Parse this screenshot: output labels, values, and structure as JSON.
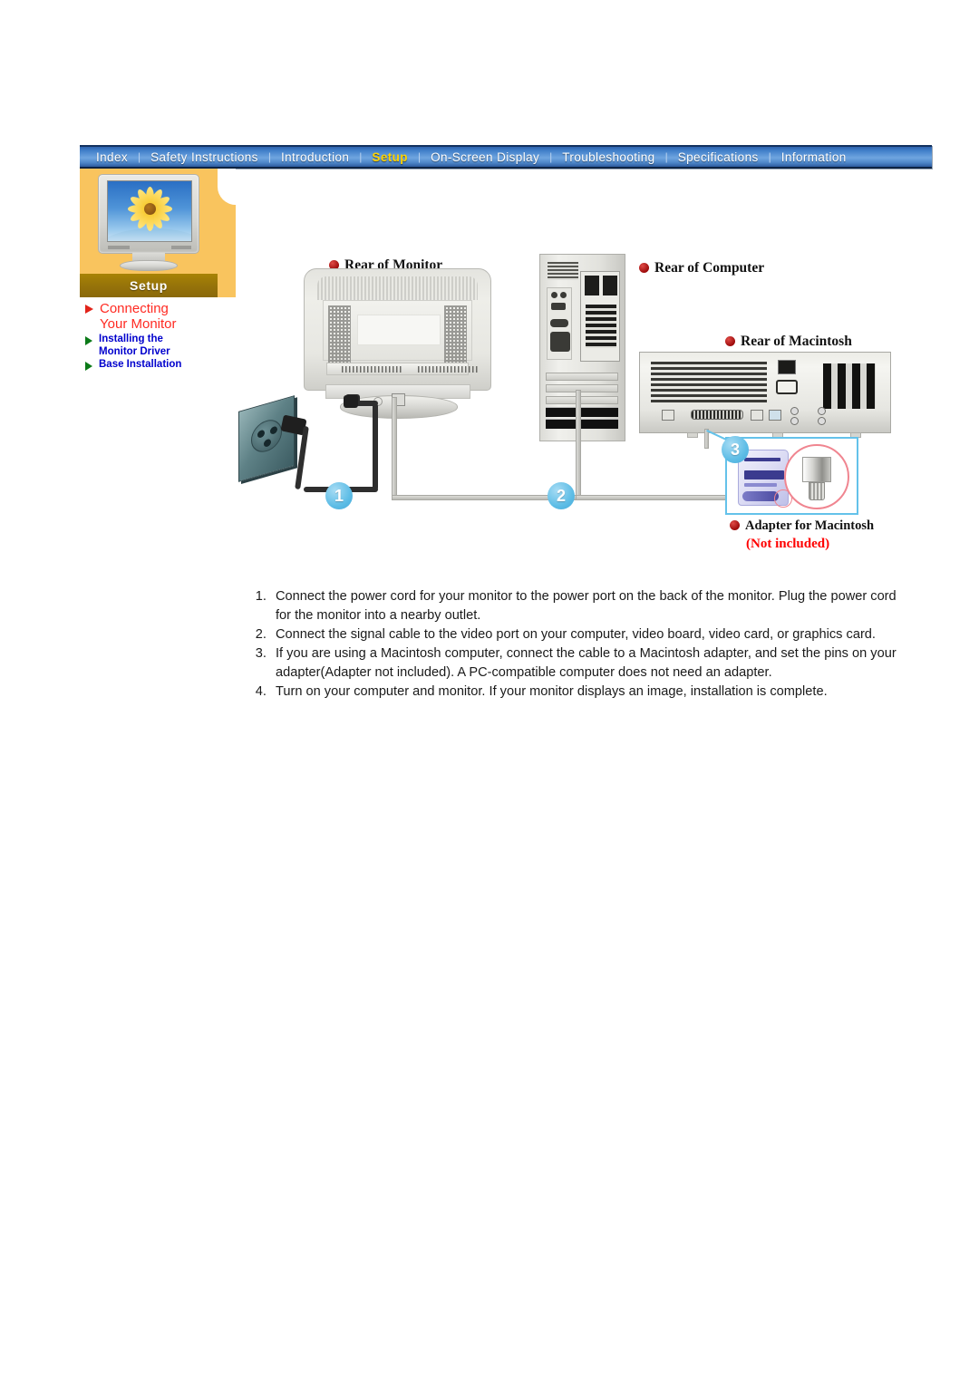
{
  "nav": {
    "items": [
      {
        "label": "Index",
        "active": false
      },
      {
        "label": "Safety Instructions",
        "active": false
      },
      {
        "label": "Introduction",
        "active": false
      },
      {
        "label": "Setup",
        "active": true
      },
      {
        "label": "On-Screen Display",
        "active": false
      },
      {
        "label": "Troubleshooting",
        "active": false
      },
      {
        "label": "Specifications",
        "active": false
      },
      {
        "label": "Information",
        "active": false
      }
    ],
    "separator": "|",
    "active_color": "#ffd400",
    "bar_color": "#3f7ec9"
  },
  "sidebar": {
    "section_title": "Setup",
    "panel_color": "#f9c45e",
    "title_bar_color": "#95720a",
    "thumbnail": "crt-monitor-sunflower-wallpaper",
    "links": [
      {
        "label_line1": "Connecting",
        "label_line2": "Your Monitor",
        "active": true,
        "color": "#ff2a22",
        "marker_color": "#e2231a"
      },
      {
        "label_line1": "Installing the",
        "label_line2": "Monitor Driver",
        "active": false,
        "color": "#0000cd",
        "marker_color": "#0b7a18"
      },
      {
        "label_line1": "Base Installation",
        "label_line2": "",
        "active": false,
        "color": "#0000cd",
        "marker_color": "#0b7a18"
      }
    ]
  },
  "diagram": {
    "labels": {
      "rear_of_monitor": "Rear of Monitor",
      "rear_of_computer": "Rear of Computer",
      "rear_of_macintosh": "Rear of  Macintosh",
      "adapter_for_macintosh": "Adapter for Macintosh",
      "not_included": "(Not included)"
    },
    "bullet_color": "#9d0b0b",
    "not_included_color": "#ff0000",
    "callout_color": "#5ebde6",
    "callouts": [
      {
        "number": "1",
        "refers_to": "power-cord-to-wall-outlet"
      },
      {
        "number": "2",
        "refers_to": "signal-cable-to-computer-video-port"
      },
      {
        "number": "3",
        "refers_to": "macintosh-adapter"
      }
    ],
    "parts": {
      "wall_outlet": "wall-power-outlet",
      "monitor": "crt-monitor-rear",
      "tower": "pc-tower-rear",
      "macintosh": "macintosh-computer-rear",
      "adapter": "macintosh-video-adapter",
      "magnifier": "adapter-pin-closeup"
    }
  },
  "instructions": {
    "steps": [
      "Connect the power cord for your monitor to the power port on the back of the monitor. Plug the power cord for the monitor into a nearby outlet.",
      "Connect the signal cable to the video port on your computer, video board, video card, or graphics card.",
      "If you are using a Macintosh computer, connect the cable to a Macintosh adapter, and set the pins on your adapter(Adapter not included). A PC-compatible computer does not need an adapter.",
      "Turn on your computer and monitor. If your monitor displays an image, installation is complete."
    ]
  }
}
